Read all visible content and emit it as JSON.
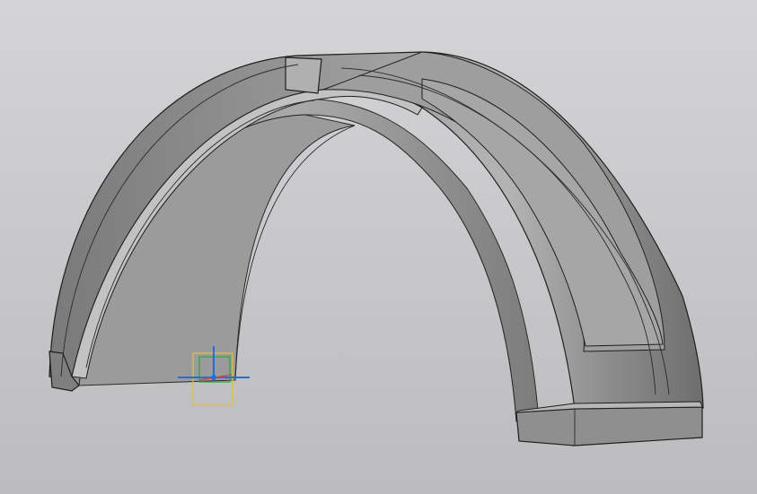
{
  "viewport": {
    "background_top": "#d4d4d6",
    "background_bottom": "#bcbcbe"
  },
  "model": {
    "shape": "arched-fender",
    "body_color": "#8a8a8a",
    "edge_color": "#1e1e1e"
  },
  "icons": {
    "origin": "coordinate-origin-icon",
    "gizmo": "sketch-plane-gizmo-icon"
  },
  "colors": {
    "axis_x": "#1e6fe0",
    "axis_y": "#d24a3a",
    "axis_z": "#2fa84a",
    "axis_frame": "#e0c040"
  }
}
